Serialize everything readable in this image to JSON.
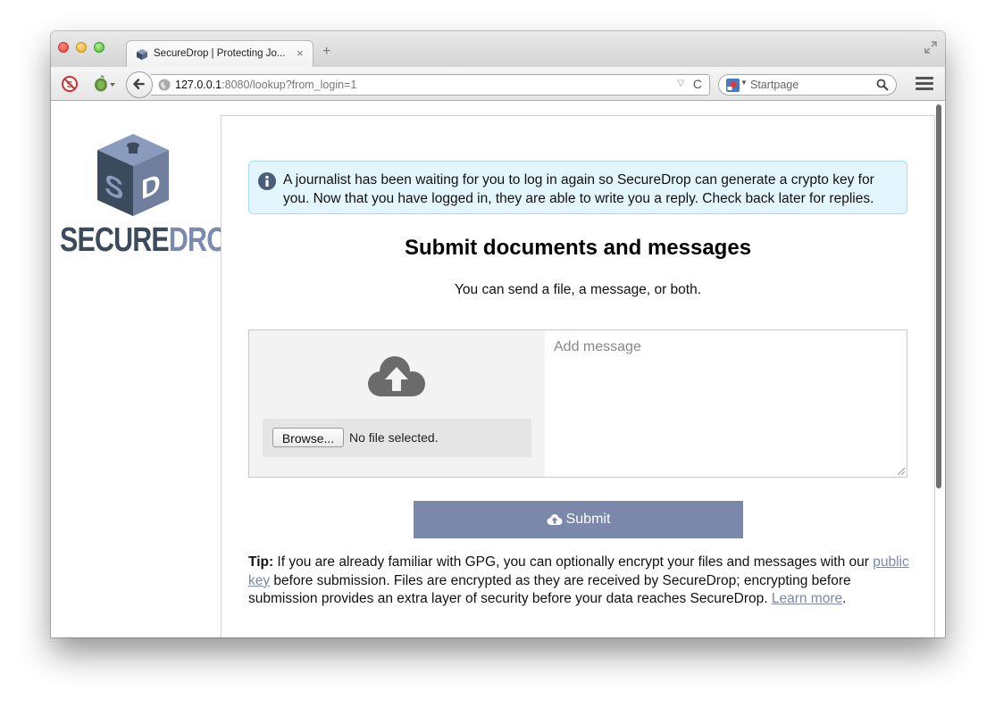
{
  "browser": {
    "tab_title": "SecureDrop | Protecting Jo...",
    "tab_close": "×",
    "new_tab": "+",
    "url_host": "127.0.0.1",
    "url_rest": ":8080/lookup?from_login=1",
    "url_dropdown": "▽",
    "url_reload": "C",
    "search_engine_placeholder": "Startpage"
  },
  "logo": {
    "secure": "SECURE",
    "drop": "DROP"
  },
  "notice": {
    "text": "A journalist has been waiting for you to log in again so SecureDrop can generate a crypto key for you. Now that you have logged in, they are able to write you a reply. Check back later for replies."
  },
  "main": {
    "title": "Submit documents and messages",
    "subtitle": "You can send a file, a message, or both.",
    "browse_label": "Browse...",
    "file_status": "No file selected.",
    "message_placeholder": "Add message",
    "submit_label": "Submit"
  },
  "tip": {
    "label": "Tip:",
    "text_1": " If you are already familiar with GPG, you can optionally encrypt your files and messages with our ",
    "link_public_key": "public key",
    "text_2": " before submission. Files are encrypted as they are received by SecureDrop; encrypting before submission provides an extra layer of security before your data reaches SecureDrop. ",
    "link_learn_more": "Learn more",
    "text_3": "."
  },
  "colors": {
    "accent": "#7b87ab",
    "notice_bg": "#e3f6fd",
    "notice_border": "#a6dcf0",
    "logo_dark": "#3b4a5c"
  }
}
